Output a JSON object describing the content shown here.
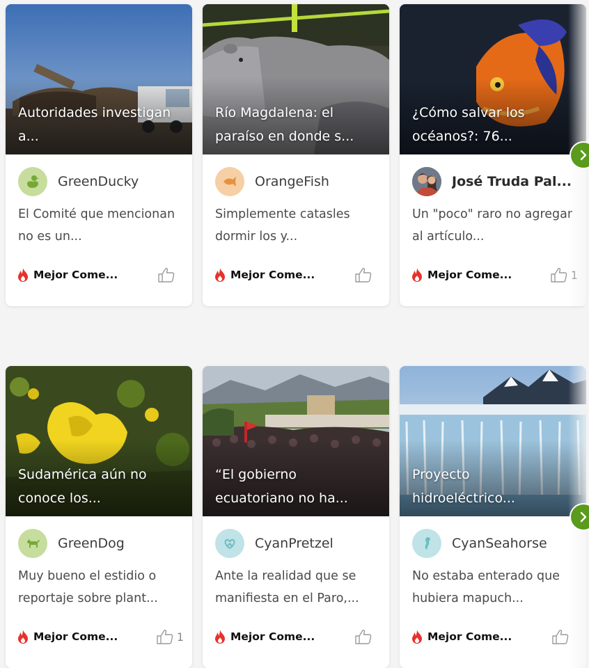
{
  "cards": [
    {
      "title": "Autoridades investigan a...",
      "user": "GreenDucky",
      "avatar_icon": "duck-icon",
      "avatar_bg": "#c6dd9d",
      "avatar_fg": "#77a836",
      "comment": "El Comité que mencionan no es un...",
      "badge": "Mejor Come...",
      "likes": ""
    },
    {
      "title": "Río Magdalena: el paraíso en donde s...",
      "user": "OrangeFish",
      "avatar_icon": "fish-icon",
      "avatar_bg": "#f6cfa4",
      "avatar_fg": "#e6913f",
      "comment": "Simplemente catasles dormir los y...",
      "badge": "Mejor Come...",
      "likes": ""
    },
    {
      "title": "¿Cómo salvar los océanos?: 76...",
      "user": "José Truda Pal...",
      "avatar_icon": "profile-photo",
      "avatar_bg": "#7a7f8a",
      "avatar_fg": "#ffffff",
      "comment": "Un \"poco\" raro no agregar al artículo...",
      "badge": "Mejor Come...",
      "likes": "1"
    },
    {
      "title": "Sudamérica aún no conoce los...",
      "user": "GreenDog",
      "avatar_icon": "dog-icon",
      "avatar_bg": "#c6dd9d",
      "avatar_fg": "#77a836",
      "comment": "Muy bueno el estidio o reportaje sobre plant...",
      "badge": "Mejor Come...",
      "likes": "1"
    },
    {
      "title": "“El gobierno ecuatoriano no ha...",
      "user": "CyanPretzel",
      "avatar_icon": "pretzel-icon",
      "avatar_bg": "#bfe3e6",
      "avatar_fg": "#6fbcc4",
      "comment": "Ante la realidad que se manifiesta en el Paro,...",
      "badge": "Mejor Come...",
      "likes": ""
    },
    {
      "title": "Proyecto hidroeléctrico...",
      "user": "CyanSeahorse",
      "avatar_icon": "seahorse-icon",
      "avatar_bg": "#bfe3e6",
      "avatar_fg": "#6fbcc4",
      "comment": "No estaba enterado que hubiera mapuch...",
      "badge": "Mejor Come...",
      "likes": ""
    }
  ],
  "colors": {
    "accent_green": "#5a9a1c",
    "fire_red": "#e5322b"
  }
}
